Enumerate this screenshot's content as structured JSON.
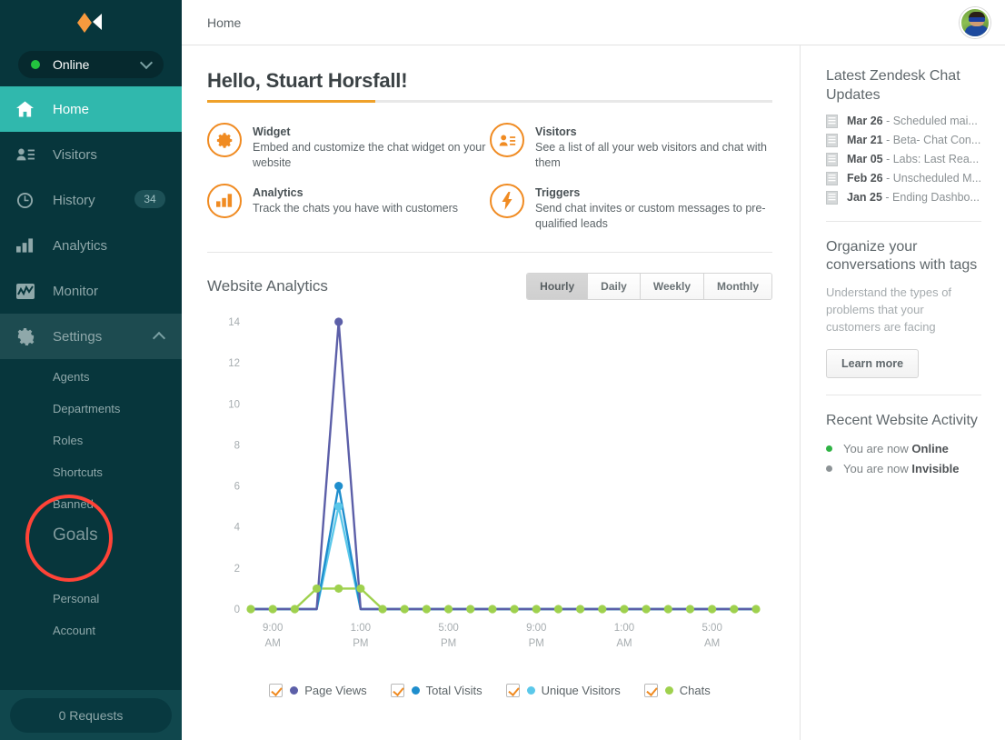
{
  "sidebar": {
    "logo_name": "zendesk-chat-logo",
    "status": {
      "label": "Online",
      "dot_color": "#23c43f"
    },
    "nav": [
      {
        "label": "Home",
        "icon": "home-icon",
        "active": true
      },
      {
        "label": "Visitors",
        "icon": "visitors-icon",
        "active": false
      },
      {
        "label": "History",
        "icon": "clock-icon",
        "active": false,
        "badge": "34"
      },
      {
        "label": "Analytics",
        "icon": "bar-chart-icon",
        "active": false
      },
      {
        "label": "Monitor",
        "icon": "monitor-icon",
        "active": false
      },
      {
        "label": "Settings",
        "icon": "gear-icon",
        "active": false,
        "expanded": true
      }
    ],
    "subnav": [
      {
        "label": "Agents"
      },
      {
        "label": "Departments"
      },
      {
        "label": "Roles"
      },
      {
        "label": "Shortcuts"
      },
      {
        "label": "Banned"
      },
      {
        "label": "Goals",
        "highlighted": true,
        "highlight_color": "#ff4337"
      },
      {
        "label": "Personal"
      },
      {
        "label": "Account"
      }
    ],
    "requests_label": "0 Requests"
  },
  "topbar": {
    "breadcrumb": "Home",
    "avatar_name": "user-avatar"
  },
  "main": {
    "greeting": "Hello, Stuart Horsfall!",
    "tiles": [
      {
        "icon": "gear-icon",
        "title": "Widget",
        "desc": "Embed and customize the chat widget on your website"
      },
      {
        "icon": "visitors-icon",
        "title": "Visitors",
        "desc": "See a list of all your web visitors and chat with them"
      },
      {
        "icon": "bar-chart-icon",
        "title": "Analytics",
        "desc": "Track the chats you have with customers"
      },
      {
        "icon": "bolt-icon",
        "title": "Triggers",
        "desc": "Send chat invites or custom messages to pre-qualified leads"
      }
    ],
    "analytics_title": "Website Analytics",
    "range_tabs": [
      {
        "label": "Hourly",
        "active": true
      },
      {
        "label": "Daily",
        "active": false
      },
      {
        "label": "Weekly",
        "active": false
      },
      {
        "label": "Monthly",
        "active": false
      }
    ]
  },
  "chart_data": {
    "type": "line",
    "title": "Website Analytics",
    "xlabel": "",
    "ylabel": "",
    "ylim": [
      0,
      14
    ],
    "yticks": [
      0,
      2,
      4,
      6,
      8,
      10,
      12,
      14
    ],
    "grid": false,
    "legend_position": "bottom",
    "x": [
      "8:00 AM",
      "9:00 AM",
      "10:00 AM",
      "11:00 AM",
      "12:00 PM",
      "1:00 PM",
      "2:00 PM",
      "3:00 PM",
      "4:00 PM",
      "5:00 PM",
      "6:00 PM",
      "7:00 PM",
      "8:00 PM",
      "9:00 PM",
      "10:00 PM",
      "11:00 PM",
      "12:00 AM",
      "1:00 AM",
      "2:00 AM",
      "3:00 AM",
      "4:00 AM",
      "5:00 AM",
      "6:00 AM",
      "7:00 AM"
    ],
    "xtick_labels": [
      "9:00 AM",
      "1:00 PM",
      "5:00 PM",
      "9:00 PM",
      "1:00 AM",
      "5:00 AM"
    ],
    "xtick_indices": [
      1,
      5,
      9,
      13,
      17,
      21
    ],
    "series": [
      {
        "name": "Page Views",
        "color": "#5c5fa8",
        "checked": true,
        "values": [
          0,
          0,
          0,
          0,
          14,
          0,
          0,
          0,
          0,
          0,
          0,
          0,
          0,
          0,
          0,
          0,
          0,
          0,
          0,
          0,
          0,
          0,
          0,
          0
        ]
      },
      {
        "name": "Total Visits",
        "color": "#1f8ecd",
        "checked": true,
        "values": [
          0,
          0,
          0,
          0,
          6,
          0,
          0,
          0,
          0,
          0,
          0,
          0,
          0,
          0,
          0,
          0,
          0,
          0,
          0,
          0,
          0,
          0,
          0,
          0
        ]
      },
      {
        "name": "Unique Visitors",
        "color": "#5bc8ea",
        "checked": true,
        "values": [
          0,
          0,
          0,
          0,
          5,
          0,
          0,
          0,
          0,
          0,
          0,
          0,
          0,
          0,
          0,
          0,
          0,
          0,
          0,
          0,
          0,
          0,
          0,
          0
        ]
      },
      {
        "name": "Chats",
        "color": "#9fd14e",
        "checked": true,
        "values": [
          0,
          0,
          0,
          1,
          1,
          1,
          0,
          0,
          0,
          0,
          0,
          0,
          0,
          0,
          0,
          0,
          0,
          0,
          0,
          0,
          0,
          0,
          0,
          0
        ]
      }
    ]
  },
  "rail": {
    "updates_heading": "Latest Zendesk Chat Updates",
    "updates": [
      {
        "date": "Mar 26",
        "text": " - Scheduled mai..."
      },
      {
        "date": "Mar 21",
        "text": " - Beta- Chat Con..."
      },
      {
        "date": "Mar 05",
        "text": " - Labs: Last Rea..."
      },
      {
        "date": "Feb 26",
        "text": " - Unscheduled M..."
      },
      {
        "date": "Jan 25",
        "text": " - Ending Dashbo..."
      }
    ],
    "tags_heading": "Organize your conversations with tags",
    "tags_sub": "Understand the types of problems that your customers are facing",
    "learn_more": "Learn more",
    "activity_heading": "Recent Website Activity",
    "activity": [
      {
        "prefix": "You are now ",
        "state": "Online",
        "dot_color": "#2fb344"
      },
      {
        "prefix": "You are now ",
        "state": "Invisible",
        "dot_color": "#8d9396"
      }
    ]
  }
}
